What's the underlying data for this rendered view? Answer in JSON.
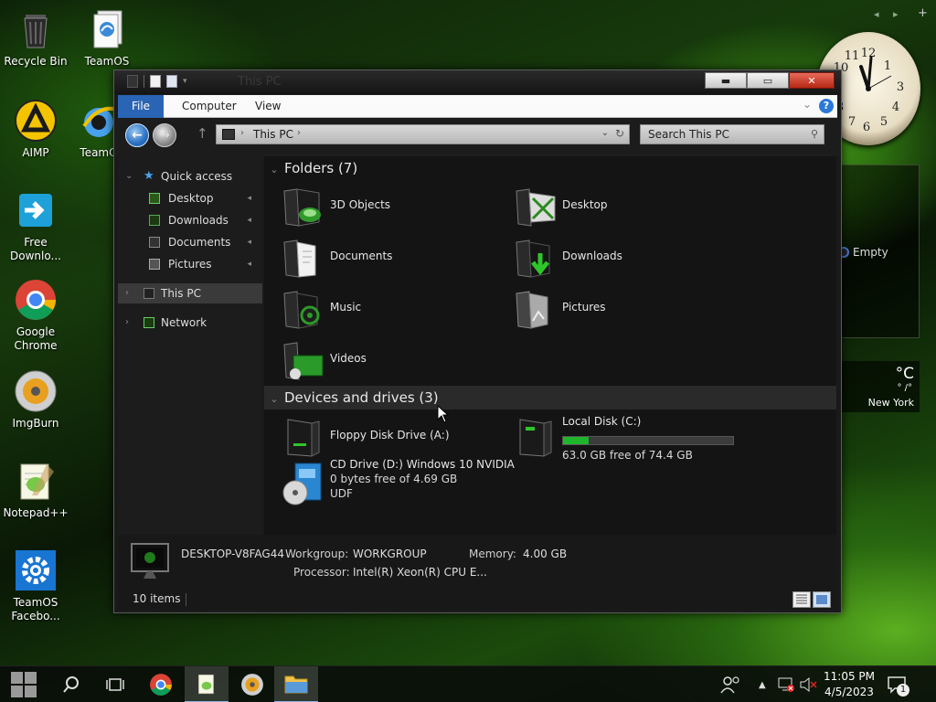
{
  "desktop": {
    "icons": [
      {
        "label": "Recycle Bin"
      },
      {
        "label": "TeamOS"
      },
      {
        "label": "AIMP"
      },
      {
        "label": "TeamO"
      },
      {
        "label": "Free Downlo..."
      },
      {
        "label": "Google Chrome"
      },
      {
        "label": "ImgBurn"
      },
      {
        "label": "Notepad++"
      },
      {
        "label": "TeamOS Facebo..."
      }
    ]
  },
  "widgets": {
    "top_nav": {
      "prev": "◂",
      "next": "▸",
      "add": "+"
    },
    "recycle_status": "Empty",
    "weather": {
      "unit": "°C",
      "range": "° /°",
      "city": "New York"
    }
  },
  "explorer": {
    "title": "This PC",
    "window_buttons": {
      "minimize": "▬",
      "maximize": "▭",
      "close": "✕"
    },
    "ribbon": {
      "tabs": [
        "File",
        "Computer",
        "View"
      ],
      "help": "?",
      "collapse": "⌄"
    },
    "nav": {
      "back": "←",
      "forward": "→",
      "up": "↑"
    },
    "address": {
      "crumb": "This PC",
      "sep": "›",
      "dropdown": "⌄",
      "refresh": "↻"
    },
    "search": {
      "placeholder": "Search This PC"
    },
    "navpane": {
      "quick_access": "Quick access",
      "quick_items": [
        "Desktop",
        "Downloads",
        "Documents",
        "Pictures"
      ],
      "this_pc": "This PC",
      "network": "Network"
    },
    "folders_header": "Folders (7)",
    "folders": [
      "3D Objects",
      "Desktop",
      "Documents",
      "Downloads",
      "Music",
      "Pictures",
      "Videos"
    ],
    "devices_header": "Devices and drives (3)",
    "drives": [
      {
        "name": "Floppy Disk Drive (A:)"
      },
      {
        "name": "Local Disk (C:)",
        "free": "63.0 GB free of 74.4 GB",
        "used_fraction": 0.153
      },
      {
        "name": "CD Drive (D:) Windows 10 NVIDIA",
        "free": "0 bytes free of 4.69 GB",
        "fs": "UDF"
      }
    ],
    "details": {
      "computer": "DESKTOP-V8FAG44",
      "workgroup_label": "Workgroup:",
      "workgroup": "WORKGROUP",
      "memory_label": "Memory:",
      "memory": "4.00 GB",
      "processor_label": "Processor:",
      "processor": "Intel(R) Xeon(R) CPU E..."
    },
    "status": {
      "items": "10 items"
    }
  },
  "taskbar": {
    "time": "11:05 PM",
    "date": "4/5/2023",
    "notification_count": "1"
  }
}
